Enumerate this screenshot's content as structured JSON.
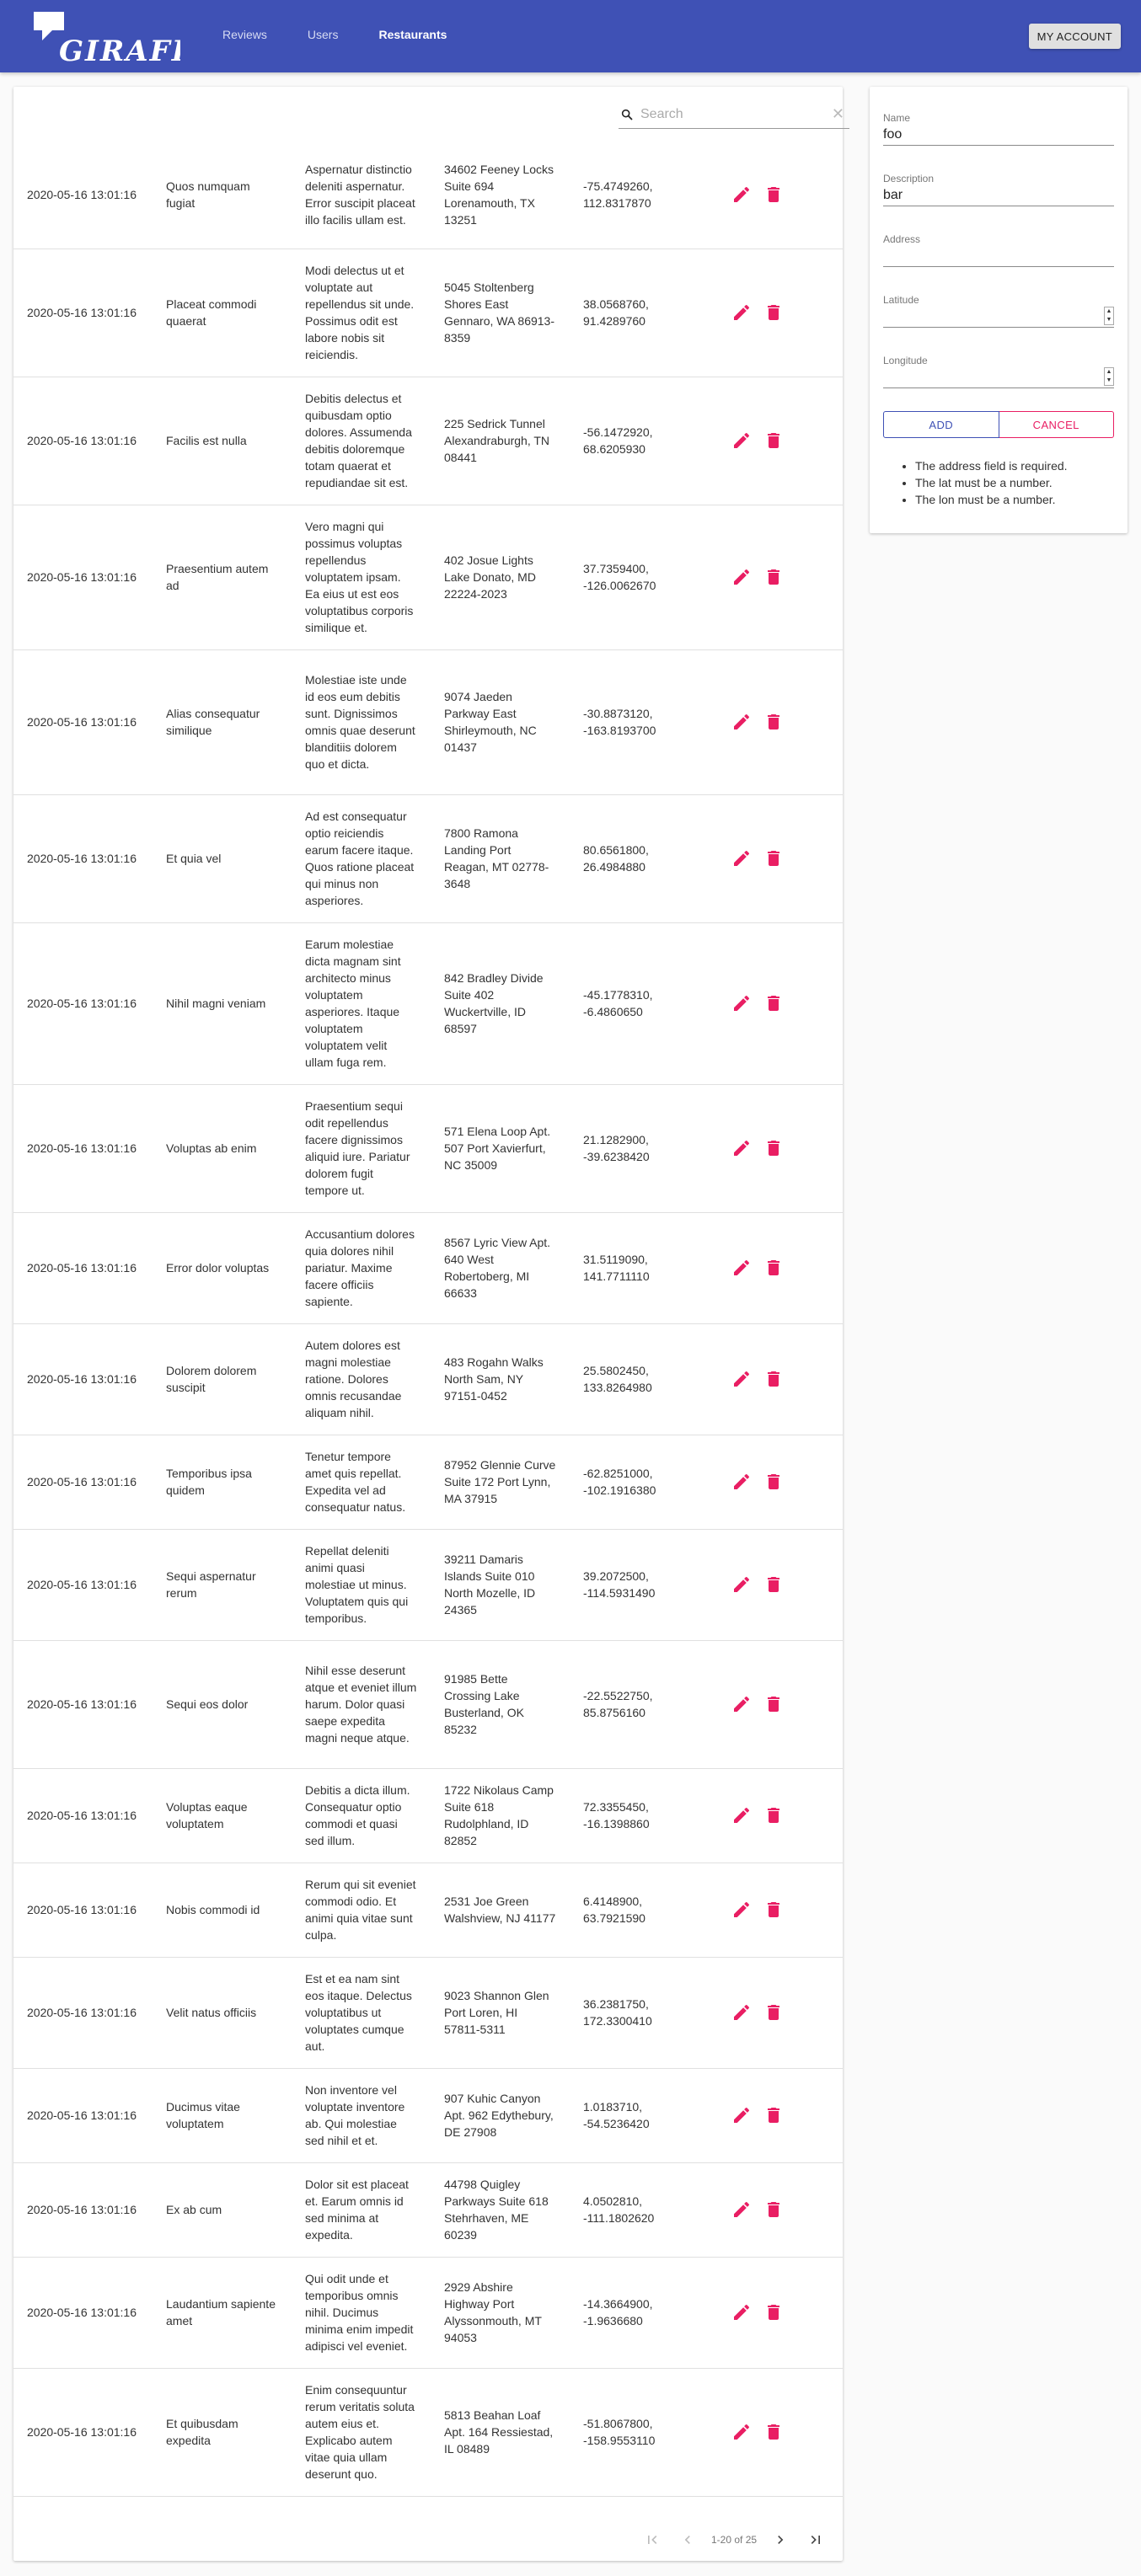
{
  "header": {
    "brand": "GIRAFFE",
    "nav": [
      {
        "label": "Reviews",
        "active": false
      },
      {
        "label": "Users",
        "active": false
      },
      {
        "label": "Restaurants",
        "active": true
      }
    ],
    "account_label": "MY ACCOUNT"
  },
  "search": {
    "placeholder": "Search",
    "value": ""
  },
  "rows": [
    {
      "date": "2020-05-16 13:01:16",
      "name": "Quos numquam fugiat",
      "description": "Aspernatur distinctio deleniti aspernatur. Error suscipit placeat illo facilis ullam est.",
      "address": "34602 Feeney Locks Suite 694 Lorenamouth, TX 13251",
      "coords": "-75.4749260, 112.8317870"
    },
    {
      "date": "2020-05-16 13:01:16",
      "name": "Placeat commodi quaerat",
      "description": "Modi delectus ut et voluptate aut repellendus sit unde. Possimus odit est labore nobis sit reiciendis.",
      "address": "5045 Stoltenberg Shores East Gennaro, WA 86913-8359",
      "coords": "38.0568760, 91.4289760"
    },
    {
      "date": "2020-05-16 13:01:16",
      "name": "Facilis est nulla",
      "description": "Debitis delectus et quibusdam optio dolores. Assumenda debitis doloremque totam quaerat et repudiandae sit est.",
      "address": "225 Sedrick Tunnel Alexandraburgh, TN 08441",
      "coords": "-56.1472920, 68.6205930"
    },
    {
      "date": "2020-05-16 13:01:16",
      "name": "Praesentium autem ad",
      "description": "Vero magni qui possimus voluptas repellendus voluptatem ipsam. Ea eius ut est eos voluptatibus corporis similique et.",
      "address": "402 Josue Lights Lake Donato, MD 22224-2023",
      "coords": "37.7359400, -126.0062670"
    },
    {
      "date": "2020-05-16 13:01:16",
      "name": "Alias consequatur similique",
      "description": "Molestiae iste unde id eos eum debitis sunt. Dignissimos omnis quae deserunt blanditiis dolorem quo et dicta.",
      "address": "9074 Jaeden Parkway East Shirleymouth, NC 01437",
      "coords": "-30.8873120, -163.8193700"
    },
    {
      "date": "2020-05-16 13:01:16",
      "name": "Et quia vel",
      "description": "Ad est consequatur optio reiciendis earum facere itaque. Quos ratione placeat qui minus non asperiores.",
      "address": "7800 Ramona Landing Port Reagan, MT 02778-3648",
      "coords": "80.6561800, 26.4984880"
    },
    {
      "date": "2020-05-16 13:01:16",
      "name": "Nihil magni veniam",
      "description": "Earum molestiae dicta magnam sint architecto minus voluptatem asperiores. Itaque voluptatem voluptatem velit ullam fuga rem.",
      "address": "842 Bradley Divide Suite 402 Wuckertville, ID 68597",
      "coords": "-45.1778310, -6.4860650"
    },
    {
      "date": "2020-05-16 13:01:16",
      "name": "Voluptas ab enim",
      "description": "Praesentium sequi odit repellendus facere dignissimos aliquid iure. Pariatur dolorem fugit tempore ut.",
      "address": "571 Elena Loop Apt. 507 Port Xavierfurt, NC 35009",
      "coords": "21.1282900, -39.6238420"
    },
    {
      "date": "2020-05-16 13:01:16",
      "name": "Error dolor voluptas",
      "description": "Accusantium dolores quia dolores nihil pariatur. Maxime facere officiis sapiente.",
      "address": "8567 Lyric View Apt. 640 West Robertoberg, MI 66633",
      "coords": "31.5119090, 141.7711110"
    },
    {
      "date": "2020-05-16 13:01:16",
      "name": "Dolorem dolorem suscipit",
      "description": "Autem dolores est magni molestiae ratione. Dolores omnis recusandae aliquam nihil.",
      "address": "483 Rogahn Walks North Sam, NY 97151-0452",
      "coords": "25.5802450, 133.8264980"
    },
    {
      "date": "2020-05-16 13:01:16",
      "name": "Temporibus ipsa quidem",
      "description": "Tenetur tempore amet quis repellat. Expedita vel ad consequatur natus.",
      "address": "87952 Glennie Curve Suite 172 Port Lynn, MA 37915",
      "coords": "-62.8251000, -102.1916380"
    },
    {
      "date": "2020-05-16 13:01:16",
      "name": "Sequi aspernatur rerum",
      "description": "Repellat deleniti animi quasi molestiae ut minus. Voluptatem quis qui temporibus.",
      "address": "39211 Damaris Islands Suite 010 North Mozelle, ID 24365",
      "coords": "39.2072500, -114.5931490"
    },
    {
      "date": "2020-05-16 13:01:16",
      "name": "Sequi eos dolor",
      "description": "Nihil esse deserunt atque et eveniet illum harum. Dolor quasi saepe expedita magni neque atque.",
      "address": "91985 Bette Crossing Lake Busterland, OK 85232",
      "coords": "-22.5522750, 85.8756160"
    },
    {
      "date": "2020-05-16 13:01:16",
      "name": "Voluptas eaque voluptatem",
      "description": "Debitis a dicta illum. Consequatur optio commodi et quasi sed illum.",
      "address": "1722 Nikolaus Camp Suite 618 Rudolphland, ID 82852",
      "coords": "72.3355450, -16.1398860"
    },
    {
      "date": "2020-05-16 13:01:16",
      "name": "Nobis commodi id",
      "description": "Rerum qui sit eveniet commodi odio. Et animi quia vitae sunt culpa.",
      "address": "2531 Joe Green Walshview, NJ 41177",
      "coords": "6.4148900, 63.7921590"
    },
    {
      "date": "2020-05-16 13:01:16",
      "name": "Velit natus officiis",
      "description": "Est et ea nam sint eos itaque. Delectus voluptatibus ut voluptates cumque aut.",
      "address": "9023 Shannon Glen Port Loren, HI 57811-5311",
      "coords": "36.2381750, 172.3300410"
    },
    {
      "date": "2020-05-16 13:01:16",
      "name": "Ducimus vitae voluptatem",
      "description": "Non inventore vel voluptate inventore ab. Qui molestiae sed nihil et et.",
      "address": "907 Kuhic Canyon Apt. 962 Edythebury, DE 27908",
      "coords": "1.0183710, -54.5236420"
    },
    {
      "date": "2020-05-16 13:01:16",
      "name": "Ex ab cum",
      "description": "Dolor sit est placeat et. Earum omnis id sed minima at expedita.",
      "address": "44798 Quigley Parkways Suite 618 Stehrhaven, ME 60239",
      "coords": "4.0502810, -111.1802620"
    },
    {
      "date": "2020-05-16 13:01:16",
      "name": "Laudantium sapiente amet",
      "description": "Qui odit unde et temporibus omnis nihil. Ducimus minima enim impedit adipisci vel eveniet.",
      "address": "2929 Abshire Highway Port Alyssonmouth, MT 94053",
      "coords": "-14.3664900, -1.9636680"
    },
    {
      "date": "2020-05-16 13:01:16",
      "name": "Et quibusdam expedita",
      "description": "Enim consequuntur rerum veritatis soluta autem eius et. Explicabo autem vitae quia ullam deserunt quo.",
      "address": "5813 Beahan Loaf Apt. 164 Ressiestad, IL 08489",
      "coords": "-51.8067800, -158.9553110"
    }
  ],
  "row_icons": {
    "edit": "pencil-icon",
    "delete": "trash-icon"
  },
  "pagination": {
    "info": "1-20 of 25"
  },
  "form": {
    "name_label": "Name",
    "name_value": "foo",
    "description_label": "Description",
    "description_value": "bar",
    "address_label": "Address",
    "address_value": "",
    "latitude_label": "Latitude",
    "latitude_value": "",
    "longitude_label": "Longitude",
    "longitude_value": "",
    "add_label": "ADD",
    "cancel_label": "CANCEL",
    "errors": [
      "The address field is required.",
      "The lat must be a number.",
      "The lon must be a number."
    ]
  },
  "colors": {
    "primary": "#3f51b5",
    "accent": "#e91e63"
  }
}
